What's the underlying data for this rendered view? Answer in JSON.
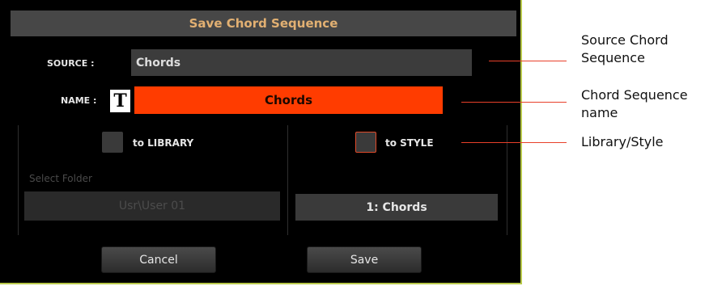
{
  "dialog": {
    "title": "Save Chord Sequence",
    "source_label": "SOURCE :",
    "source_value": "Chords",
    "name_label": "NAME :",
    "text_edit_glyph": "T",
    "name_value": "Chords",
    "library_option_label": "to LIBRARY",
    "style_option_label": "to STYLE",
    "select_folder_label": "Select Folder",
    "folder_value": "Usr\\User 01",
    "style_value": "1: Chords",
    "cancel_label": "Cancel",
    "save_label": "Save"
  },
  "callouts": [
    {
      "text": "Source Chord Sequence"
    },
    {
      "text": "Chord Sequence name"
    },
    {
      "text": "Library/Style"
    }
  ],
  "colors": {
    "accent_orange": "#ff3c00",
    "title_text": "#e2b072",
    "callout_line": "#e8402a",
    "dialog_border": "#b8c94a"
  }
}
